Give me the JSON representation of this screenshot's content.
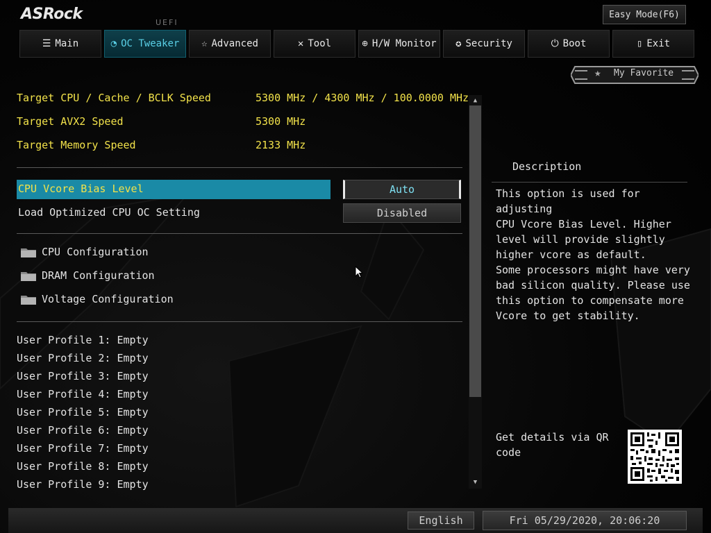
{
  "brand": {
    "logo": "ASRock",
    "uefi": "UEFI"
  },
  "easy_mode_label": "Easy Mode(F6)",
  "tabs": [
    {
      "label": "Main",
      "icon": "list-icon"
    },
    {
      "label": "OC Tweaker",
      "icon": "speedometer-icon",
      "active": true
    },
    {
      "label": "Advanced",
      "icon": "star-outline-icon"
    },
    {
      "label": "Tool",
      "icon": "tools-icon"
    },
    {
      "label": "H/W Monitor",
      "icon": "gauge-icon"
    },
    {
      "label": "Security",
      "icon": "shield-icon"
    },
    {
      "label": "Boot",
      "icon": "power-icon"
    },
    {
      "label": "Exit",
      "icon": "exit-door-icon"
    }
  ],
  "favorite_label": "My Favorite",
  "targets": [
    {
      "label": "Target CPU / Cache / BCLK Speed",
      "value": "5300 MHz / 4300 MHz / 100.0000 MHz"
    },
    {
      "label": "Target AVX2 Speed",
      "value": "5300 MHz"
    },
    {
      "label": "Target Memory Speed",
      "value": "2133 MHz"
    }
  ],
  "settings": [
    {
      "label": "CPU Vcore Bias Level",
      "value": "Auto",
      "selected": true
    },
    {
      "label": "Load Optimized CPU OC Setting",
      "value": "Disabled"
    }
  ],
  "submenus": [
    {
      "label": "CPU Configuration"
    },
    {
      "label": "DRAM Configuration"
    },
    {
      "label": "Voltage Configuration"
    }
  ],
  "profiles": [
    "User Profile 1: Empty",
    "User Profile 2: Empty",
    "User Profile 3: Empty",
    "User Profile 4: Empty",
    "User Profile 5: Empty",
    "User Profile 6: Empty",
    "User Profile 7: Empty",
    "User Profile 8: Empty",
    "User Profile 9: Empty"
  ],
  "description": {
    "title": "Description",
    "body": "This option is used for adjusting\nCPU Vcore Bias Level. Higher\nlevel will provide slightly\nhigher vcore as default.\nSome processors might have very\nbad silicon quality. Please use\nthis option to compensate more\nVcore to get stability.",
    "qr_text": "Get details via QR\ncode"
  },
  "footer": {
    "language": "English",
    "datetime": "Fri 05/29/2020, 20:06:20"
  },
  "colors": {
    "accent": "#1a8aa6",
    "label_yellow": "#f2e24a",
    "active_tab_text": "#5ad0e6"
  }
}
